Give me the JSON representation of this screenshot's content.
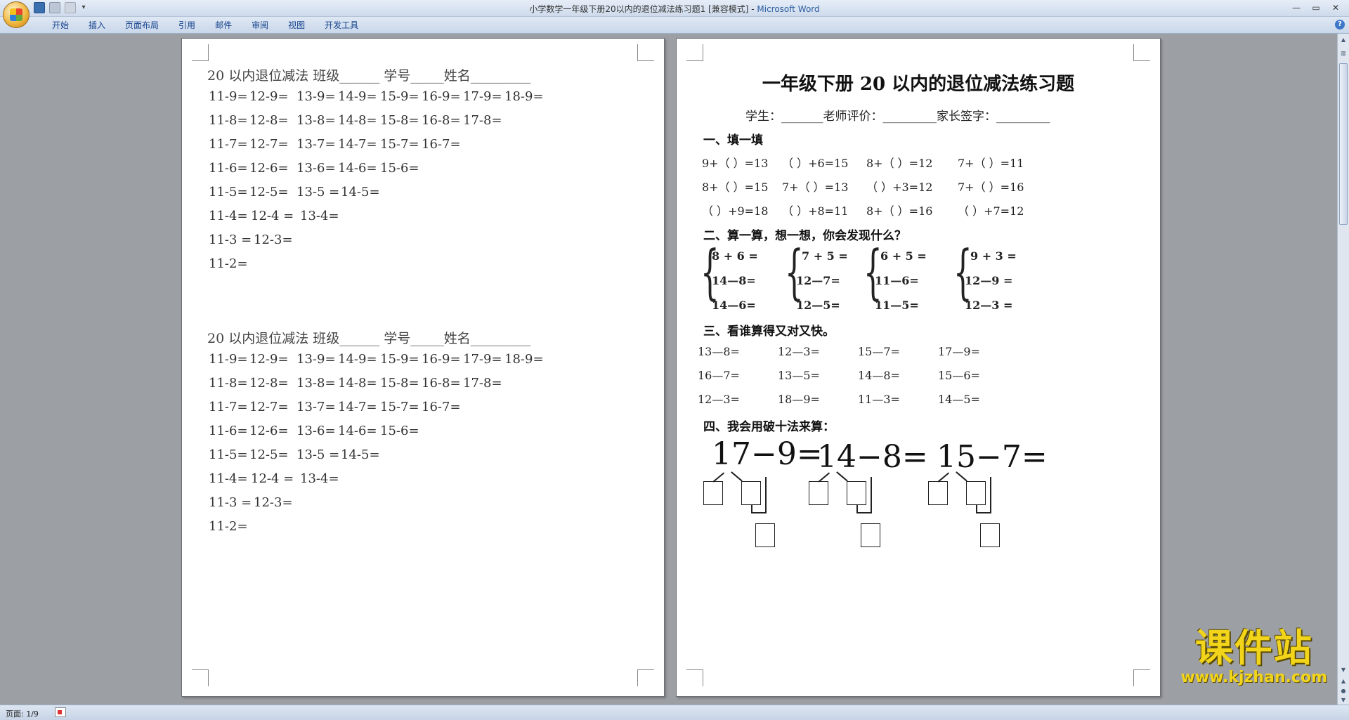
{
  "window": {
    "title_doc": "小学数学一年级下册20以内的退位减法练习题1 [兼容模式] - ",
    "title_app": "Microsoft Word"
  },
  "ribbon_tabs": [
    "开始",
    "插入",
    "页面布局",
    "引用",
    "邮件",
    "审阅",
    "视图",
    "开发工具"
  ],
  "left_page": {
    "block1": {
      "header": "20 以内退位减法    班级______  学号_____姓名_________",
      "rows": [
        [
          "11-9=",
          "12-9=",
          "13-9=",
          "14-9=",
          "15-9=",
          "16-9=",
          "17-9=",
          "18-9="
        ],
        [
          "11-8=",
          "12-8=",
          "13-8=",
          "14-8=",
          "15-8=",
          "16-8=",
          "17-8="
        ],
        [
          "11-7=",
          "12-7=",
          "13-7=",
          "14-7=",
          "15-7=",
          "16-7="
        ],
        [
          "11-6=",
          "12-6=",
          "13-6=",
          "14-6=",
          "15-6="
        ],
        [
          "11-5=",
          "12-5=",
          "13-5 =",
          "14-5="
        ],
        [
          "11-4=",
          "12-4 =",
          "13-4="
        ],
        [
          "11-3 =",
          "12-3="
        ],
        [
          "11-2="
        ]
      ]
    },
    "block2": {
      "header": "20 以内退位减法    班级______  学号_____姓名_________",
      "rows": [
        [
          "11-9=",
          "12-9=",
          "13-9=",
          "14-9=",
          "15-9=",
          "16-9=",
          "17-9=",
          "18-9="
        ],
        [
          "11-8=",
          "12-8=",
          "13-8=",
          "14-8=",
          "15-8=",
          "16-8=",
          "17-8="
        ],
        [
          "11-7=",
          "12-7=",
          "13-7=",
          "14-7=",
          "15-7=",
          "16-7="
        ],
        [
          "11-6=",
          "12-6=",
          "13-6=",
          "14-6=",
          "15-6="
        ],
        [
          "11-5=",
          "12-5=",
          "13-5 =",
          "14-5="
        ],
        [
          "11-4=",
          "12-4 =",
          "13-4="
        ],
        [
          "11-3 =",
          "12-3="
        ],
        [
          "11-2="
        ]
      ]
    }
  },
  "right_page": {
    "title": "一年级下册 20 以内的退位减法练习题",
    "subtitle": "学生：_______老师评价：_________家长签字：_________",
    "sec1": {
      "heading": "一、填一填",
      "rows": [
        [
          "9+（    ）=13",
          "（    ）+6=15",
          "8+（    ）=12",
          "7+（    ）=11"
        ],
        [
          "8+（    ）=15",
          "7+（    ）=13",
          "（    ）+3=12",
          "7+（    ）=16"
        ],
        [
          "（    ）+9=18",
          "（    ）+8=11",
          "8+（    ）=16",
          "（    ）+7=12"
        ]
      ]
    },
    "sec2": {
      "heading": "二、算一算，想一想，你会发现什么？",
      "groups": [
        [
          "8 + 6 =",
          "14—8=",
          "14—6="
        ],
        [
          "7 + 5 =",
          "12—7=",
          "12—5="
        ],
        [
          "6 + 5 =",
          "11—6=",
          "11—5="
        ],
        [
          "9 + 3 =",
          "12—9 =",
          "12—3 ="
        ]
      ]
    },
    "sec3": {
      "heading": "三、看谁算得又对又快。",
      "rows": [
        [
          "13—8=",
          "12—3=",
          "15—7=",
          "17—9="
        ],
        [
          "16—7=",
          "13—5=",
          "14—8=",
          "15—6="
        ],
        [
          "12—3=",
          "18—9=",
          "11—3=",
          "14—5="
        ]
      ]
    },
    "sec4": {
      "heading": "四、我会用破十法来算：",
      "equations": [
        "17−9=",
        "14−8=",
        "15−7="
      ]
    }
  },
  "status": {
    "page": "页面: 1/9"
  },
  "watermark": {
    "cn": "课件站",
    "en": "www.kjzhan.com"
  }
}
